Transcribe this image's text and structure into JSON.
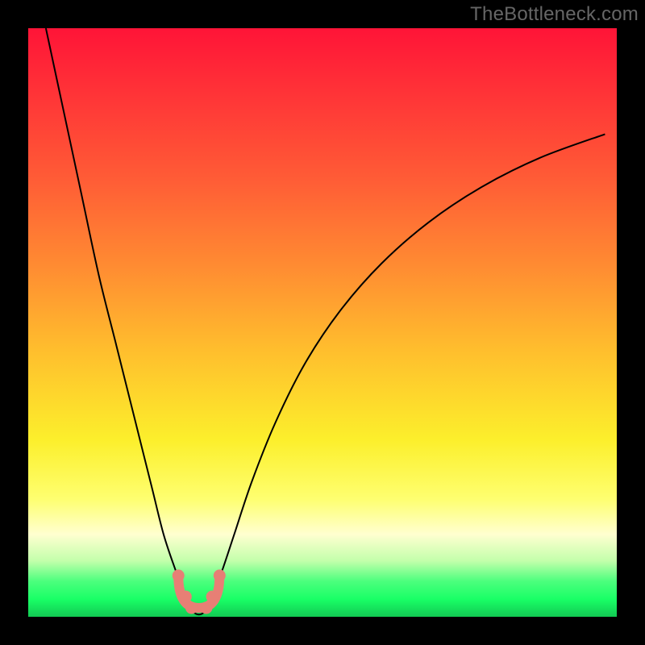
{
  "watermark": "TheBottleneck.com",
  "colors": {
    "frame": "#000000",
    "watermark": "#666666",
    "curve": "#000000",
    "band_marker": "#e77f75",
    "gradient_stops": [
      {
        "offset": 0.0,
        "color": "#ff1437"
      },
      {
        "offset": 0.12,
        "color": "#ff3637"
      },
      {
        "offset": 0.25,
        "color": "#ff5a36"
      },
      {
        "offset": 0.4,
        "color": "#ff8a32"
      },
      {
        "offset": 0.55,
        "color": "#ffbf2d"
      },
      {
        "offset": 0.7,
        "color": "#fcef2c"
      },
      {
        "offset": 0.8,
        "color": "#feff70"
      },
      {
        "offset": 0.86,
        "color": "#ffffd0"
      },
      {
        "offset": 0.905,
        "color": "#c3ffab"
      },
      {
        "offset": 0.94,
        "color": "#4bff7d"
      },
      {
        "offset": 0.97,
        "color": "#19ff66"
      },
      {
        "offset": 1.0,
        "color": "#12c953"
      }
    ]
  },
  "chart_data": {
    "type": "line",
    "title": "",
    "xlabel": "",
    "ylabel": "",
    "xlim": [
      0,
      100
    ],
    "ylim": [
      0,
      100
    ],
    "series": [
      {
        "name": "bottleneck-curve",
        "x": [
          3,
          6,
          9,
          12,
          15,
          18,
          21,
          23,
          25,
          26.5,
          27.5,
          28.5,
          29.5,
          30.5,
          31.5,
          33,
          35,
          38,
          42,
          47,
          53,
          60,
          68,
          77,
          87,
          98
        ],
        "y": [
          100,
          86,
          72,
          58,
          46,
          34,
          22,
          14,
          8,
          4,
          1.5,
          0.5,
          0.5,
          1.5,
          4,
          8,
          14,
          23,
          33,
          43,
          52,
          60,
          67,
          73,
          78,
          82
        ]
      }
    ],
    "optimum_band": {
      "x_center": 29.0,
      "x_range": [
        25.5,
        32.5
      ],
      "description": "U-shaped marker near curve minimum"
    },
    "background": "vertical gradient red→orange→yellow→pale→green representing bottleneck severity (top=high, bottom=low)"
  }
}
